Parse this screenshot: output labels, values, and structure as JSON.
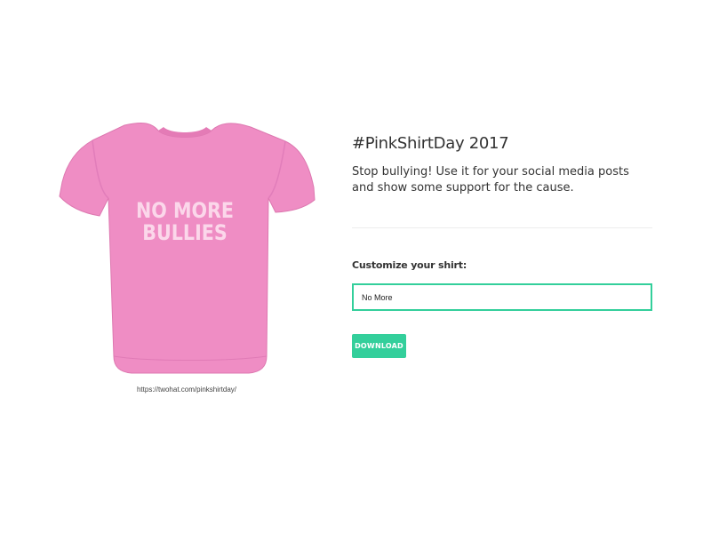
{
  "shirt": {
    "line1": "NO MORE",
    "line2": "BULLIES",
    "color": "#ef8dc4",
    "text_color": "#fbd7ea",
    "credit": "https://twohat.com/pinkshirtday/"
  },
  "content": {
    "title": "#PinkShirtDay 2017",
    "description": "Stop bullying! Use it for your social media posts and show some support for the cause."
  },
  "form": {
    "label": "Customize your shirt:",
    "input_value": "No More",
    "download_label": "DOWNLOAD"
  },
  "colors": {
    "accent": "#33cf9b",
    "divider": "#ececec"
  }
}
